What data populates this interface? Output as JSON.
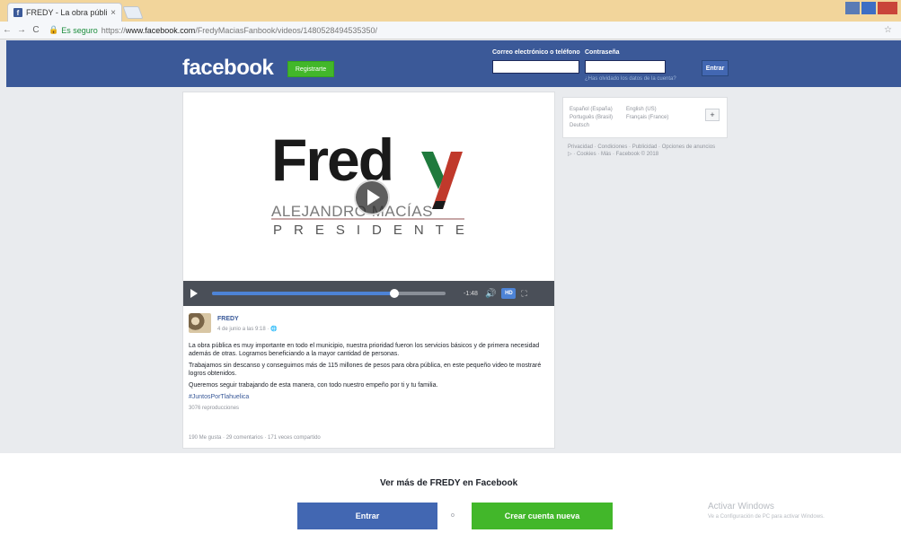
{
  "browser": {
    "tab_title": "FREDY - La obra pública ...",
    "tab_close": "×",
    "favicon": "f",
    "url_secure": "Es seguro",
    "url_prefix": "https://",
    "url_host": "www.facebook.com",
    "url_path": "/FredyMaciasFanbook/videos/1480528494535350/",
    "nav_back": "←",
    "nav_forward": "→",
    "nav_reload": "C",
    "lock": "🔒",
    "bookmark": "☆"
  },
  "header": {
    "logo": "facebook",
    "register_label": "Registrarte",
    "email_label": "Correo electrónico o teléfono",
    "password_label": "Contraseña",
    "login_label": "Entrar",
    "forgot_label": "¿Has olvidado los datos de la cuenta?"
  },
  "video": {
    "brand_main": "Fred",
    "brand_sub": "ALEJANDRO MACÍAS",
    "brand_tag": "PRESIDENTE",
    "progress": 0.78,
    "time": "-1:48",
    "hd_label": "HD",
    "colors": {
      "green": "#1f7a3d",
      "red": "#c0392b",
      "bar": "#4d83d6"
    }
  },
  "post": {
    "author": "FREDY",
    "date": "4 de junio a las 9:18 · 🌐",
    "paragraphs": [
      "La obra pública es muy importante en todo el municipio, nuestra prioridad fueron los servicios básicos y de primera necesidad además de otras. Logramos beneficiando a la mayor cantidad de personas.",
      "Trabajamos sin descanso y conseguimos más de 115 millones de pesos para obra pública, en este pequeño video te mostraré logros obtenidos.",
      "Queremos seguir trabajando de esta manera, con todo nuestro empeño por ti y tu familia."
    ],
    "hashtag": "#JuntosPorTlahuelica",
    "reproductions": "3076 reproducciones",
    "stats": "190 Me gusta · 29 comentarios · 171 veces compartido"
  },
  "sidebar": {
    "lang_col1": [
      "Español (España)",
      "Português (Brasil)",
      "Deutsch"
    ],
    "lang_col2": [
      "English (US)",
      "Français (France)"
    ],
    "lang_more": "+",
    "footer": "Privacidad · Condiciones · Publicidad · Opciones de anuncios ▷ · Cookies · Más · Facebook © 2018"
  },
  "bottom": {
    "see_more": "Ver más de FREDY en Facebook",
    "login": "Entrar",
    "or": "o",
    "create": "Crear cuenta nueva",
    "activate_title": "Activar Windows",
    "activate_sub": "Ve a Configuración de PC para activar Windows."
  }
}
